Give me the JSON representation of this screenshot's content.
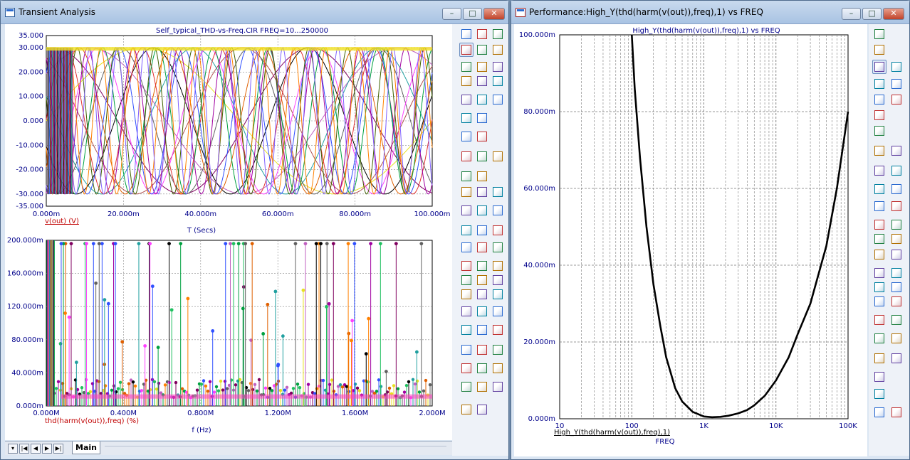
{
  "transient_window": {
    "title": "Transient Analysis",
    "tab_main": "Main",
    "tab_nav": [
      "▾",
      "|◀",
      "◀",
      "▶",
      "▶|"
    ]
  },
  "performance_window": {
    "title": "Performance:High_Y(thd(harm(v(out)),freq),1) vs FREQ"
  },
  "chart_data": [
    {
      "type": "line",
      "title": "Self_typical_THD-vs-Freq.CIR FREQ=10...250000",
      "xlabel": "T (Secs)",
      "ylabel": "v(out) (V)",
      "xlim": [
        0,
        0.1
      ],
      "ylim": [
        -35,
        35
      ],
      "x_ticks": [
        "0.000m",
        "20.000m",
        "40.000m",
        "60.000m",
        "80.000m",
        "100.000m"
      ],
      "y_ticks": [
        "35.000",
        "30.000",
        "20.000",
        "10.000",
        "0.000",
        "-10.000",
        "-20.000",
        "-30.000",
        "-35.000"
      ],
      "amplitude": 30,
      "note_series": "family of sine waves, 30 V amplitude, swept frequency",
      "series": [
        {
          "freq_hz": 10,
          "color": "#e8e020"
        },
        {
          "freq_hz": 12.5,
          "color": "#c060c0"
        },
        {
          "freq_hz": 15,
          "color": "#800060"
        },
        {
          "freq_hz": 18,
          "color": "#b05050"
        },
        {
          "freq_hz": 21,
          "color": "#20a0a0"
        },
        {
          "freq_hz": 25,
          "color": "#000000"
        },
        {
          "freq_hz": 30,
          "color": "#606060"
        },
        {
          "freq_hz": 35,
          "color": "#ff40ff"
        },
        {
          "freq_hz": 42,
          "color": "#e06000"
        },
        {
          "freq_hz": 50,
          "color": "#e03030"
        },
        {
          "freq_hz": 60,
          "color": "#3050ff"
        },
        {
          "freq_hz": 70,
          "color": "#00a040"
        },
        {
          "freq_hz": 85,
          "color": "#a000a0"
        },
        {
          "freq_hz": 100,
          "color": "#406000"
        },
        {
          "freq_hz": 120,
          "color": "#ff8000"
        },
        {
          "freq_hz": 140,
          "color": "#8060ff"
        }
      ]
    },
    {
      "type": "scatter",
      "xlabel": "f (Hz)",
      "ylabel": "thd(harm(v(out)),freq) (%)",
      "xlim": [
        0,
        2000000
      ],
      "ylim": [
        0,
        200
      ],
      "x_ticks": [
        "0.000M",
        "0.400M",
        "0.800M",
        "1.200M",
        "1.600M",
        "2.000M"
      ],
      "y_ticks": [
        "200.000m",
        "160.000m",
        "120.000m",
        "80.000m",
        "40.000m",
        "0.000m"
      ],
      "note_series": "stem plot of harmonics from many runs"
    },
    {
      "type": "line",
      "title": "High_Y(thd(harm(v(out)),freq),1) vs FREQ",
      "xlabel": "FREQ",
      "ylabel": "High_Y(thd(harm(v(out)),freq),1)",
      "xscale": "log",
      "xlim": [
        10,
        100000
      ],
      "ylim": [
        0,
        100
      ],
      "x_ticks": [
        "10",
        "100",
        "1K",
        "10K",
        "100K"
      ],
      "y_ticks": [
        "100.000m",
        "80.000m",
        "60.000m",
        "40.000m",
        "20.000m",
        "0.000m"
      ],
      "x": [
        100,
        110,
        130,
        160,
        200,
        250,
        300,
        400,
        500,
        700,
        1000,
        1300,
        1700,
        2200,
        3000,
        4000,
        5000,
        7000,
        10000,
        15000,
        20000,
        30000,
        50000,
        70000,
        100000
      ],
      "y": [
        100,
        86,
        68,
        50,
        35,
        24,
        16,
        8,
        4.5,
        1.8,
        0.6,
        0.4,
        0.5,
        0.8,
        1.4,
        2.3,
        3.5,
        6,
        10,
        16,
        22,
        30,
        45,
        60,
        80
      ]
    }
  ]
}
